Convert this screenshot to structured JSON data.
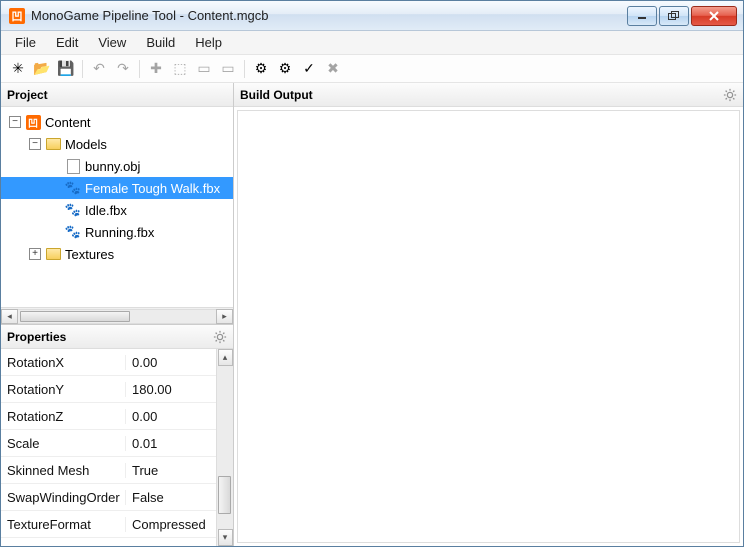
{
  "titlebar": {
    "app_glyph": "凹",
    "title": "MonoGame Pipeline Tool - Content.mgcb"
  },
  "menubar": {
    "items": [
      "File",
      "Edit",
      "View",
      "Build",
      "Help"
    ]
  },
  "toolbar": {
    "buttons": [
      {
        "name": "new-icon",
        "glyph": "✳"
      },
      {
        "name": "open-icon",
        "glyph": "📂"
      },
      {
        "name": "save-icon",
        "glyph": "💾"
      },
      {
        "sep": true
      },
      {
        "name": "undo-icon",
        "glyph": "↶",
        "dim": true
      },
      {
        "name": "redo-icon",
        "glyph": "↷",
        "dim": true
      },
      {
        "sep": true
      },
      {
        "name": "add-item-icon",
        "glyph": "✚",
        "dim": true
      },
      {
        "name": "add-existing-icon",
        "glyph": "⬚",
        "dim": true
      },
      {
        "name": "add-folder-icon",
        "glyph": "▭",
        "dim": true
      },
      {
        "name": "add-existing-folder-icon",
        "glyph": "▭",
        "dim": true
      },
      {
        "sep": true
      },
      {
        "name": "build-icon",
        "glyph": "⚙"
      },
      {
        "name": "rebuild-icon",
        "glyph": "⚙"
      },
      {
        "name": "clean-icon",
        "glyph": "✓"
      },
      {
        "name": "cancel-build-icon",
        "glyph": "✖",
        "dim": true
      }
    ]
  },
  "panels": {
    "project_title": "Project",
    "properties_title": "Properties",
    "build_output_title": "Build Output"
  },
  "tree": {
    "root": {
      "label": "Content",
      "expanded": true
    },
    "nodes": [
      {
        "indent": 1,
        "exp": "-",
        "type": "folder",
        "label": "Models"
      },
      {
        "indent": 2,
        "exp": "",
        "type": "file",
        "label": "bunny.obj"
      },
      {
        "indent": 2,
        "exp": "",
        "type": "anim",
        "label": "Female Tough Walk.fbx",
        "selected": true
      },
      {
        "indent": 2,
        "exp": "",
        "type": "anim",
        "label": "Idle.fbx"
      },
      {
        "indent": 2,
        "exp": "",
        "type": "anim",
        "label": "Running.fbx"
      },
      {
        "indent": 1,
        "exp": "+",
        "type": "folder",
        "label": "Textures"
      }
    ]
  },
  "properties": {
    "rows": [
      {
        "name": "RotationX",
        "value": "0.00"
      },
      {
        "name": "RotationY",
        "value": "180.00"
      },
      {
        "name": "RotationZ",
        "value": "0.00"
      },
      {
        "name": "Scale",
        "value": "0.01"
      },
      {
        "name": "Skinned Mesh",
        "value": "True"
      },
      {
        "name": "SwapWindingOrder",
        "value": "False"
      },
      {
        "name": "TextureFormat",
        "value": "Compressed"
      }
    ]
  }
}
